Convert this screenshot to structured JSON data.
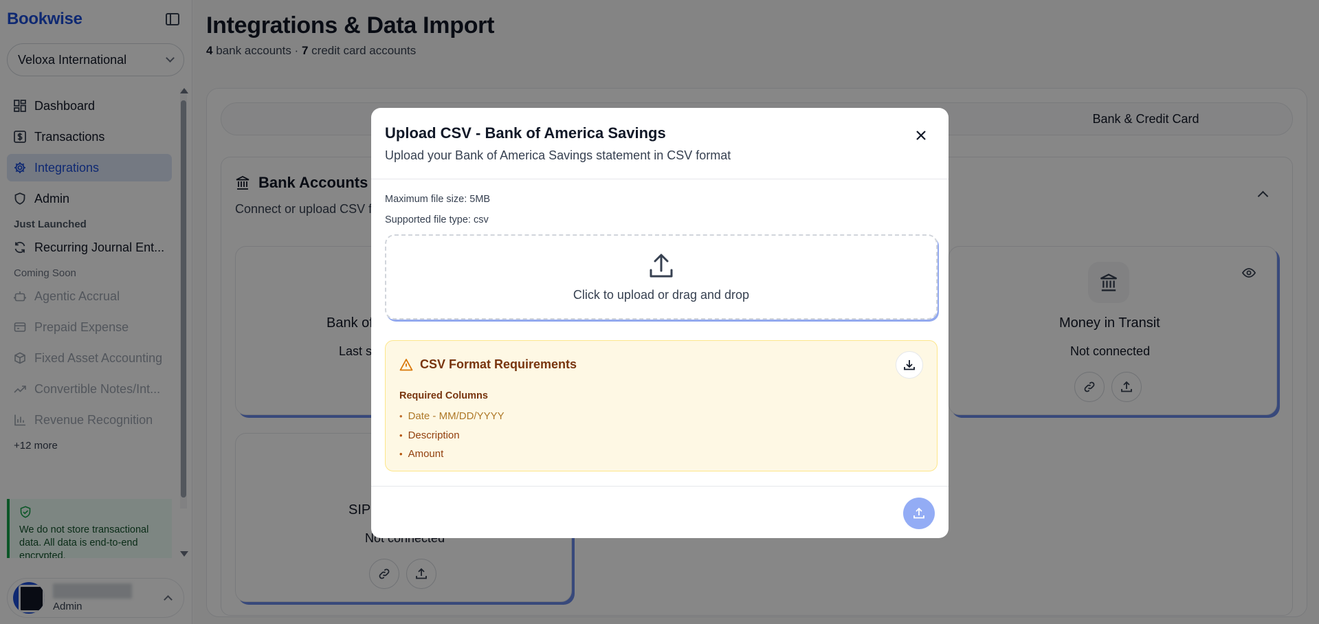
{
  "app": {
    "name": "Bookwise"
  },
  "sidebar": {
    "org": "Veloxa International",
    "nav": [
      {
        "label": "Dashboard",
        "icon": "dashboard-icon"
      },
      {
        "label": "Transactions",
        "icon": "dollar-icon"
      },
      {
        "label": "Integrations",
        "icon": "gear-icon",
        "active": true
      },
      {
        "label": "Admin",
        "icon": "shield-icon"
      }
    ],
    "just_launched_label": "Just Launched",
    "just_launched": [
      {
        "label": "Recurring Journal Ent...",
        "icon": "refresh-icon"
      }
    ],
    "coming_soon_label": "Coming Soon",
    "coming_soon": [
      {
        "label": "Agentic Accrual",
        "icon": "robot-icon"
      },
      {
        "label": "Prepaid Expense",
        "icon": "receipt-icon"
      },
      {
        "label": "Fixed Asset Accounting",
        "icon": "box-icon"
      },
      {
        "label": "Convertible Notes/Int...",
        "icon": "trend-icon"
      },
      {
        "label": "Revenue Recognition",
        "icon": "bar-chart-icon"
      }
    ],
    "more": "+12 more",
    "security_note": "We do not store transactional data. All data is end-to-end encrypted.",
    "user_role": "Admin"
  },
  "header": {
    "title": "Integrations & Data Import",
    "bank_count": "4",
    "bank_label": "bank accounts ·",
    "card_count": "7",
    "card_label": "credit card accounts"
  },
  "tabs": {
    "bank_credit": "Bank & Credit Card"
  },
  "bank_section": {
    "title": "Bank Accounts",
    "desc": "Connect or upload CSV files for your bank accounts",
    "accounts": [
      {
        "name": "Bank of America Savings",
        "status": "Last synced"
      },
      {
        "name": "Money in Transit",
        "status": "Not connected"
      },
      {
        "name": "SIP",
        "status": "Not connected"
      }
    ]
  },
  "modal": {
    "title": "Upload CSV - Bank of America Savings",
    "subtitle": "Upload your Bank of America Savings statement in CSV format",
    "max_size": "Maximum file size: 5MB",
    "file_type": "Supported file type: csv",
    "dropzone_text": "Click to upload or drag and drop",
    "req_title": "CSV Format Requirements",
    "req_cols_label": "Required Columns",
    "req_cols": [
      "Date - MM/DD/YYYY",
      "Description",
      "Amount"
    ]
  },
  "colors": {
    "brand": "#1d4ed8",
    "card_shadow": "#6b8be8",
    "submit": "#93acf5",
    "warning_bg": "#fef8e4"
  }
}
